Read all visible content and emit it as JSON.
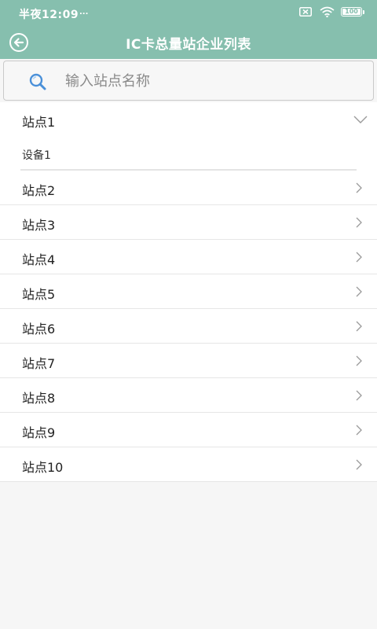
{
  "status_bar": {
    "time": "半夜12:09",
    "dots": "...",
    "battery": "100",
    "icons": [
      "sim-x-icon",
      "wifi-icon",
      "battery-icon"
    ]
  },
  "header": {
    "title": "IC卡总量站企业列表",
    "back_icon": "back-circle-arrow-icon"
  },
  "search": {
    "placeholder": "输入站点名称",
    "value": ""
  },
  "stations": [
    {
      "label": "站点1",
      "expanded": true,
      "devices": [
        {
          "label": "设备1"
        }
      ]
    },
    {
      "label": "站点2",
      "expanded": false
    },
    {
      "label": "站点3",
      "expanded": false
    },
    {
      "label": "站点4",
      "expanded": false
    },
    {
      "label": "站点5",
      "expanded": false
    },
    {
      "label": "站点6",
      "expanded": false
    },
    {
      "label": "站点7",
      "expanded": false
    },
    {
      "label": "站点8",
      "expanded": false
    },
    {
      "label": "站点9",
      "expanded": false
    },
    {
      "label": "站点10",
      "expanded": false
    }
  ],
  "colors": {
    "primary": "#86bfae",
    "search_icon": "#4a90d9",
    "chevron": "#9a9a9a"
  }
}
